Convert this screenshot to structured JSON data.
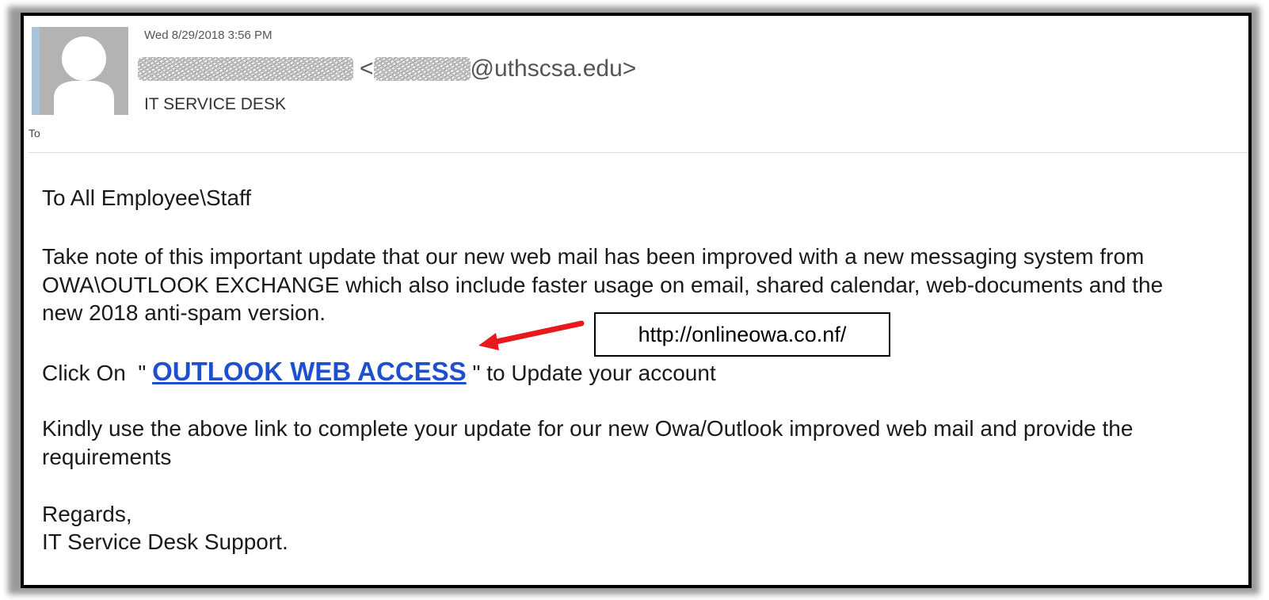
{
  "header": {
    "date": "Wed 8/29/2018 3:56 PM",
    "sender_domain": "@uthscsa.edu>",
    "subject": "IT SERVICE DESK",
    "to_label": "To",
    "avatar_icon": "person-silhouette-icon"
  },
  "body": {
    "greeting": "To All Employee\\Staff",
    "paragraph1": "Take note of this important update that our new web mail has been improved with a new messaging system from OWA\\OUTLOOK EXCHANGE which also include faster usage on email, shared calendar, web-documents and the new 2018 anti-spam version.",
    "click_prefix": "Click On  \" ",
    "link_text": "OUTLOOK WEB ACCESS",
    "click_suffix": " \" to Update your account",
    "paragraph2": "Kindly use the above link to complete your update for our new Owa/Outlook improved web mail and provide the requirements",
    "regards": "Regards,",
    "signature": "IT Service Desk Support."
  },
  "annotation": {
    "url": "http://onlineowa.co.nf/",
    "arrow_color": "#e8191c"
  },
  "colors": {
    "link": "#1f4fd1",
    "frame_border": "#000000"
  }
}
